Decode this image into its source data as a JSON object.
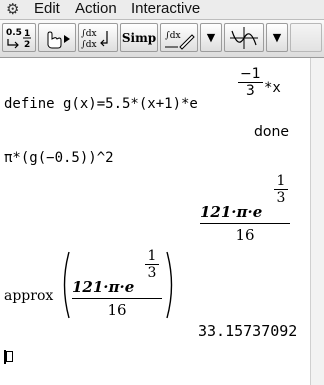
{
  "menubar": {
    "menu_icon": "gear-icon",
    "items": [
      "Edit",
      "Action",
      "Interactive"
    ]
  },
  "toolbar": {
    "buttons": [
      {
        "name": "decimal-fraction-toggle-icon",
        "label": "0.5 ↔ 1/2"
      },
      {
        "name": "hand-arrow-icon",
        "label": "☝▸"
      },
      {
        "name": "integral-convert-icon",
        "label": "∫dx ∫dx"
      },
      {
        "name": "simp-button",
        "label": "Simp"
      },
      {
        "name": "integral-pen-icon",
        "label": "∫dx"
      },
      {
        "name": "dropdown-arrow-1",
        "label": "▼"
      },
      {
        "name": "graph-icon",
        "label": "⊕"
      },
      {
        "name": "dropdown-arrow-2",
        "label": "▼"
      }
    ],
    "simp_label": "Simp"
  },
  "document": {
    "line1_input": "define g(x)=5.5*(x+1)*e",
    "line1_exp_num": "−1",
    "line1_exp_den": "3",
    "line1_exp_tail": "*x",
    "line1_output": "done",
    "line2_input": "π*(g(−0.5))^2",
    "line2_out_num_text": "121·π·e",
    "line2_out_exp_num": "1",
    "line2_out_exp_den": "3",
    "line2_out_den": "16",
    "line3_fn": "approx",
    "line3_num_text": "121·π·e",
    "line3_exp_num": "1",
    "line3_exp_den": "3",
    "line3_den": "16",
    "line3_output": "33.15737092"
  }
}
